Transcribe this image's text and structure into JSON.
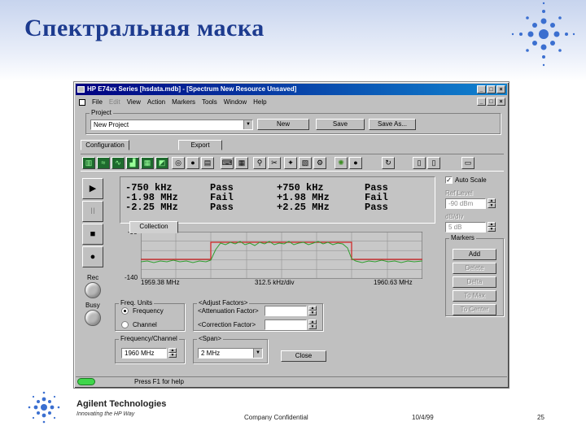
{
  "slide": {
    "title": "Спектральная маска",
    "company": "Agilent Technologies",
    "tagline": "Innovating the HP Way",
    "confidential": "Company Confidential",
    "date": "10/4/99",
    "page": "25"
  },
  "window": {
    "title": "HP E74xx Series [hsdata.mdb] - [Spectrum     New Resource     Unsaved]",
    "controls": [
      "_",
      "□",
      "×"
    ],
    "menu": [
      "File",
      "Edit",
      "View",
      "Action",
      "Markers",
      "Tools",
      "Window",
      "Help"
    ]
  },
  "project": {
    "label": "Project",
    "value": "New Project",
    "new_label": "New",
    "save_label": "Save",
    "saveas_label": "Save As..."
  },
  "tabs": [
    "Configuration",
    "Collection",
    "Export"
  ],
  "side": {
    "play": "▶",
    "pause": "II",
    "stop": "■",
    "record": "●",
    "rec_label": "Rec",
    "busy_label": "Busy"
  },
  "results": {
    "rows": [
      {
        "offset_neg": "-750 kHz",
        "status_neg": "Pass",
        "offset_pos": "+750 kHz",
        "status_pos": "Pass"
      },
      {
        "offset_neg": "-1.98 MHz",
        "status_neg": "Fail",
        "offset_pos": "+1.98 MHz",
        "status_pos": "Fail"
      },
      {
        "offset_neg": "-2.25 MHz",
        "status_neg": "Pass",
        "offset_pos": "+2.25 MHz",
        "status_pos": "Pass"
      }
    ]
  },
  "plot": {
    "y_top": "-90",
    "y_bottom": "-140",
    "x_start": "1959.38 MHz",
    "x_div": "312.5 kHz/div",
    "x_end": "1960.63 MHz",
    "trace_color": "#2e9e2e",
    "mask_color": "#d02020"
  },
  "right_panel": {
    "autoscale_label": "Auto Scale",
    "autoscale_checked": "✓",
    "ref_level_label": "Ref Level",
    "ref_level_value": "-90 dBm",
    "db_div_label": "dB/div",
    "db_div_value": "5 dB",
    "markers_label": "Markers",
    "marker_buttons": [
      "Add",
      "Delete",
      "Delta",
      "To Max",
      "To Center"
    ]
  },
  "freq_units": {
    "label": "Freq. Units",
    "options": [
      "Frequency",
      "Channel"
    ]
  },
  "adjust": {
    "label": "<Adjust Factors>",
    "attenuation": "<Attenuation Factor>",
    "correction": "<Correction Factor>"
  },
  "freq_channel": {
    "label": "Frequency/Channel",
    "value": "1960 MHz"
  },
  "span": {
    "label": "<Span>",
    "value": "2 MHz"
  },
  "close_label": "Close",
  "status": {
    "text": "Press F1 for help"
  }
}
